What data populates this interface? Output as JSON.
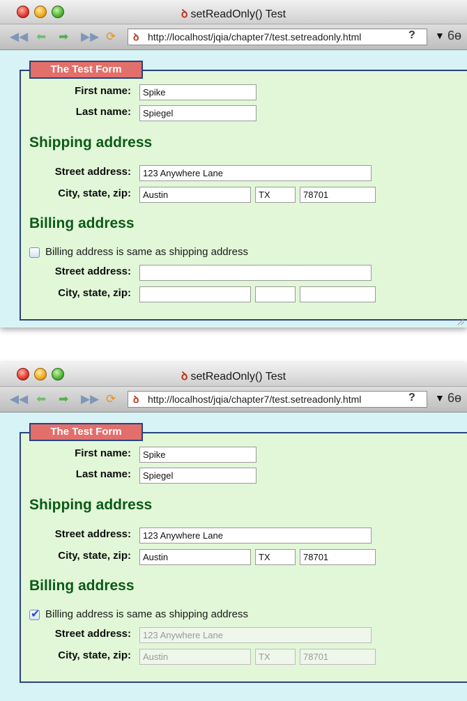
{
  "windows": [
    {
      "title": "setReadOnly() Test",
      "url": "http://localhost/jqia/chapter7/test.setreadonly.html",
      "legend": "The Test Form",
      "first_name_label": "First name:",
      "first_name": "Spike",
      "last_name_label": "Last name:",
      "last_name": "Spiegel",
      "shipping_heading": "Shipping address",
      "ship_street_label": "Street address:",
      "ship_street": "123 Anywhere Lane",
      "ship_csz_label": "City, state, zip:",
      "ship_city": "Austin",
      "ship_state": "TX",
      "ship_zip": "78701",
      "billing_heading": "Billing address",
      "same_checkbox_label": "Billing address is same as shipping address",
      "same_checked": false,
      "bill_street_label": "Street address:",
      "bill_street": "",
      "bill_csz_label": "City, state, zip:",
      "bill_city": "",
      "bill_state": "",
      "bill_zip": "",
      "help_label": "?"
    },
    {
      "title": "setReadOnly() Test",
      "url": "http://localhost/jqia/chapter7/test.setreadonly.html",
      "legend": "The Test Form",
      "first_name_label": "First name:",
      "first_name": "Spike",
      "last_name_label": "Last name:",
      "last_name": "Spiegel",
      "shipping_heading": "Shipping address",
      "ship_street_label": "Street address:",
      "ship_street": "123 Anywhere Lane",
      "ship_csz_label": "City, state, zip:",
      "ship_city": "Austin",
      "ship_state": "TX",
      "ship_zip": "78701",
      "billing_heading": "Billing address",
      "same_checkbox_label": "Billing address is same as shipping address",
      "same_checked": true,
      "bill_street_label": "Street address:",
      "bill_street": "123 Anywhere Lane",
      "bill_csz_label": "City, state, zip:",
      "bill_city": "Austin",
      "bill_state": "TX",
      "bill_zip": "78701",
      "help_label": "?"
    }
  ],
  "icons": [
    "back-icon",
    "forward-icon",
    "reload-icon",
    "page-icon",
    "dropdown-icon",
    "reader-icon"
  ]
}
